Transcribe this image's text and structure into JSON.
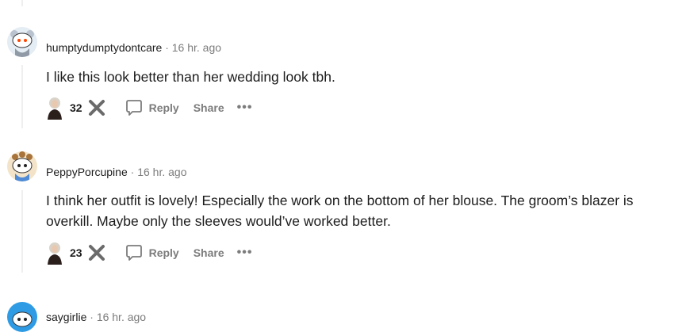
{
  "comments": [
    {
      "username": "humptydumptydontcare",
      "time": "16 hr. ago",
      "text": "I like this look better than her wedding look tbh.",
      "votes": "32",
      "reply_label": "Reply",
      "share_label": "Share",
      "more_label": "•••"
    },
    {
      "username": "PeppyPorcupine",
      "time": "16 hr. ago",
      "text": "I think her outfit is lovely! Especially the work on the bottom of her blouse. The groom’s blazer is overkill. Maybe only the sleeves would’ve worked better.",
      "votes": "23",
      "reply_label": "Reply",
      "share_label": "Share",
      "more_label": "•••"
    },
    {
      "username": "saygirlie",
      "time": "16 hr. ago"
    }
  ],
  "separator": "·",
  "colors": {
    "meta": "#7c7c7c",
    "text": "#1c1c1c",
    "thread_line": "#edeff1"
  }
}
